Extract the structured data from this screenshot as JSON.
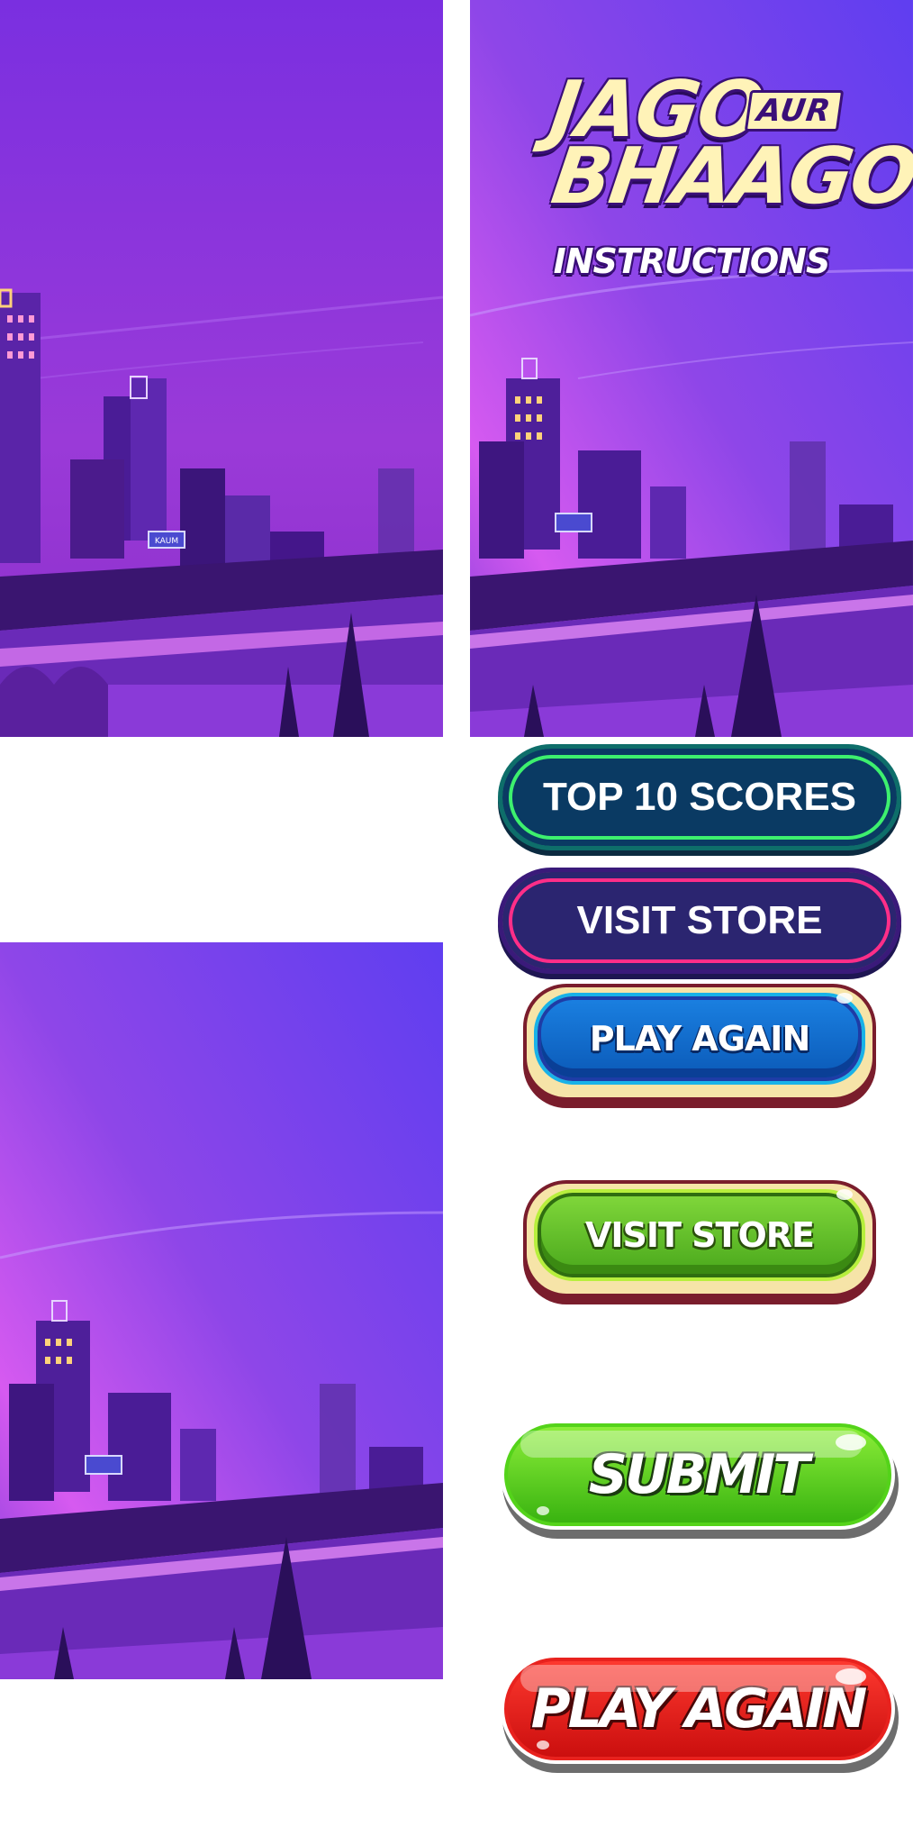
{
  "game": {
    "title_line1": "JAGO",
    "title_connector": "AUR",
    "title_line2": "BHAAGO",
    "instructions_label": "INSTRUCTIONS"
  },
  "billboard_text": "KAUM",
  "buttons": {
    "top10_label": "TOP 10 SCORES",
    "visit_store_neon_label": "VISIT STORE",
    "play_again_blue_label": "PLAY AGAIN",
    "visit_store_green_label": "VISIT STORE",
    "submit_label": "SUBMIT",
    "play_again_red_label": "PLAY AGAIN"
  },
  "colors": {
    "sky_top": "#6b3ee6",
    "sky_mid": "#b84de8",
    "city_dark": "#3a1680",
    "accent_pink": "#ff4fd8",
    "neon_green": "#3df06e",
    "neon_pink": "#ff2e88"
  }
}
